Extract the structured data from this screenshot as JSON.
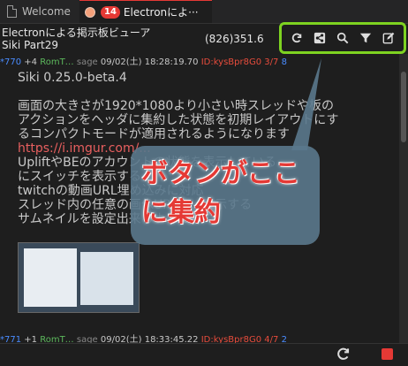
{
  "tabs": [
    {
      "label": "Welcome"
    },
    {
      "badge": "14",
      "label": "Electronによ···"
    }
  ],
  "header": {
    "title_line1": "Electronによる掲示板ビューア",
    "title_line2": "Siki Part29",
    "speed": "(826)351.6"
  },
  "toolbar": {
    "icons": [
      "refresh-icon",
      "share-icon",
      "search-icon",
      "filter-icon",
      "edit-icon"
    ]
  },
  "post1": {
    "number": "770",
    "plus": "+4",
    "name": "RomT…",
    "mail": "sage",
    "date": "09/02(土) 18:28:19.70",
    "id": "ID:kysBpr8G0",
    "count": "3/7",
    "extra": "8",
    "lines": [
      "Siki 0.25.0-beta.4",
      "",
      "画面の大きさが1920*1080より小さい時スレッドや板の",
      "アクションをヘッダに集約した状態を初期レイアウトにす",
      "るコンパクトモードが適用されるようになります",
      "https://i.imgur.com/...",
      "UpliftやBEのアカウントの状態を表示している",
      "にスイッチを表示するよ",
      "twitchの動画URL埋め込みに対応",
      "スレッド内の任意の画像URLを...表示する",
      "サムネイルを設定出来るように"
    ],
    "link": "https://i.imgur.com/..."
  },
  "overlay": {
    "line1": "ボタンがここ",
    "line2": "に集約"
  },
  "post2": {
    "number": "771",
    "plus": "+1",
    "name": "RomT…",
    "mail": "sage",
    "date": "09/02(土) 18:33:45.22",
    "id": "ID:kysBpr8G0",
    "count": "4/7",
    "extra": "2"
  }
}
